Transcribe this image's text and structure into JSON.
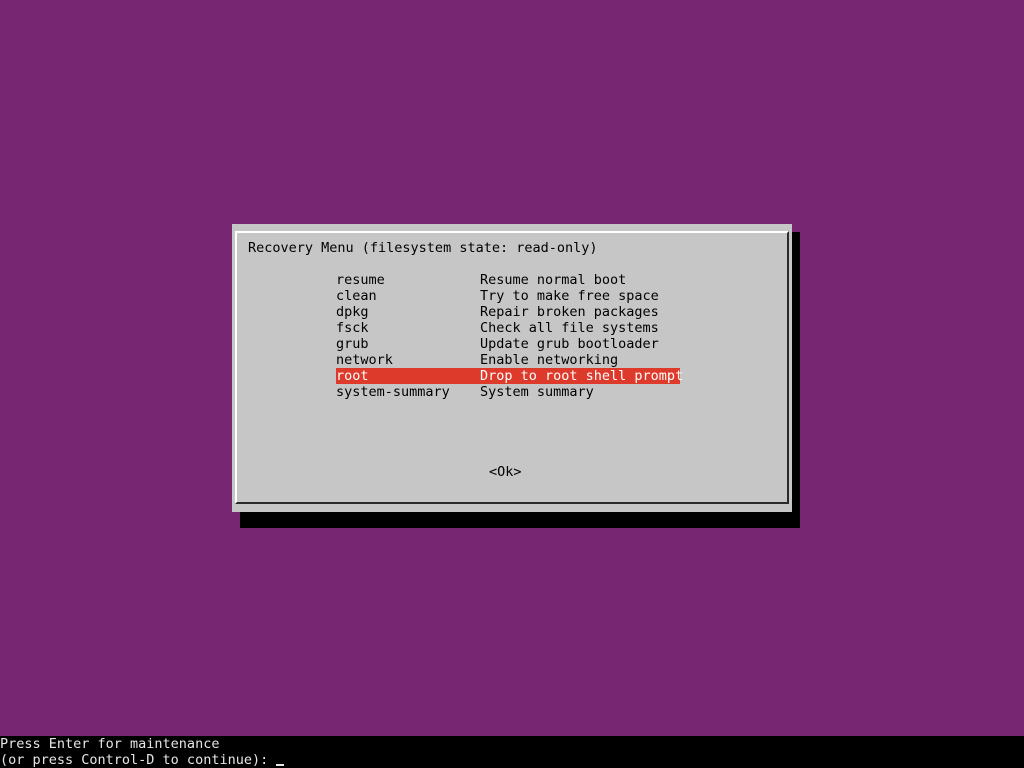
{
  "colors": {
    "background": "#772772",
    "dialog": "#c6c6c6",
    "selection": "#dd3a2c",
    "shadow": "#000000",
    "console_bg": "#000000"
  },
  "dialog": {
    "title": "Recovery Menu (filesystem state: read-only)",
    "items": [
      {
        "tag": "resume",
        "desc": "Resume normal boot",
        "selected": false
      },
      {
        "tag": "clean",
        "desc": "Try to make free space",
        "selected": false
      },
      {
        "tag": "dpkg",
        "desc": "Repair broken packages",
        "selected": false
      },
      {
        "tag": "fsck",
        "desc": "Check all file systems",
        "selected": false
      },
      {
        "tag": "grub",
        "desc": "Update grub bootloader",
        "selected": false
      },
      {
        "tag": "network",
        "desc": "Enable networking",
        "selected": false
      },
      {
        "tag": "root",
        "desc": "Drop to root shell prompt",
        "selected": true
      },
      {
        "tag": "system-summary",
        "desc": "System summary",
        "selected": false
      }
    ],
    "ok_label": "<Ok>"
  },
  "console": {
    "line1": "Press Enter for maintenance",
    "line2": "(or press Control-D to continue):"
  }
}
